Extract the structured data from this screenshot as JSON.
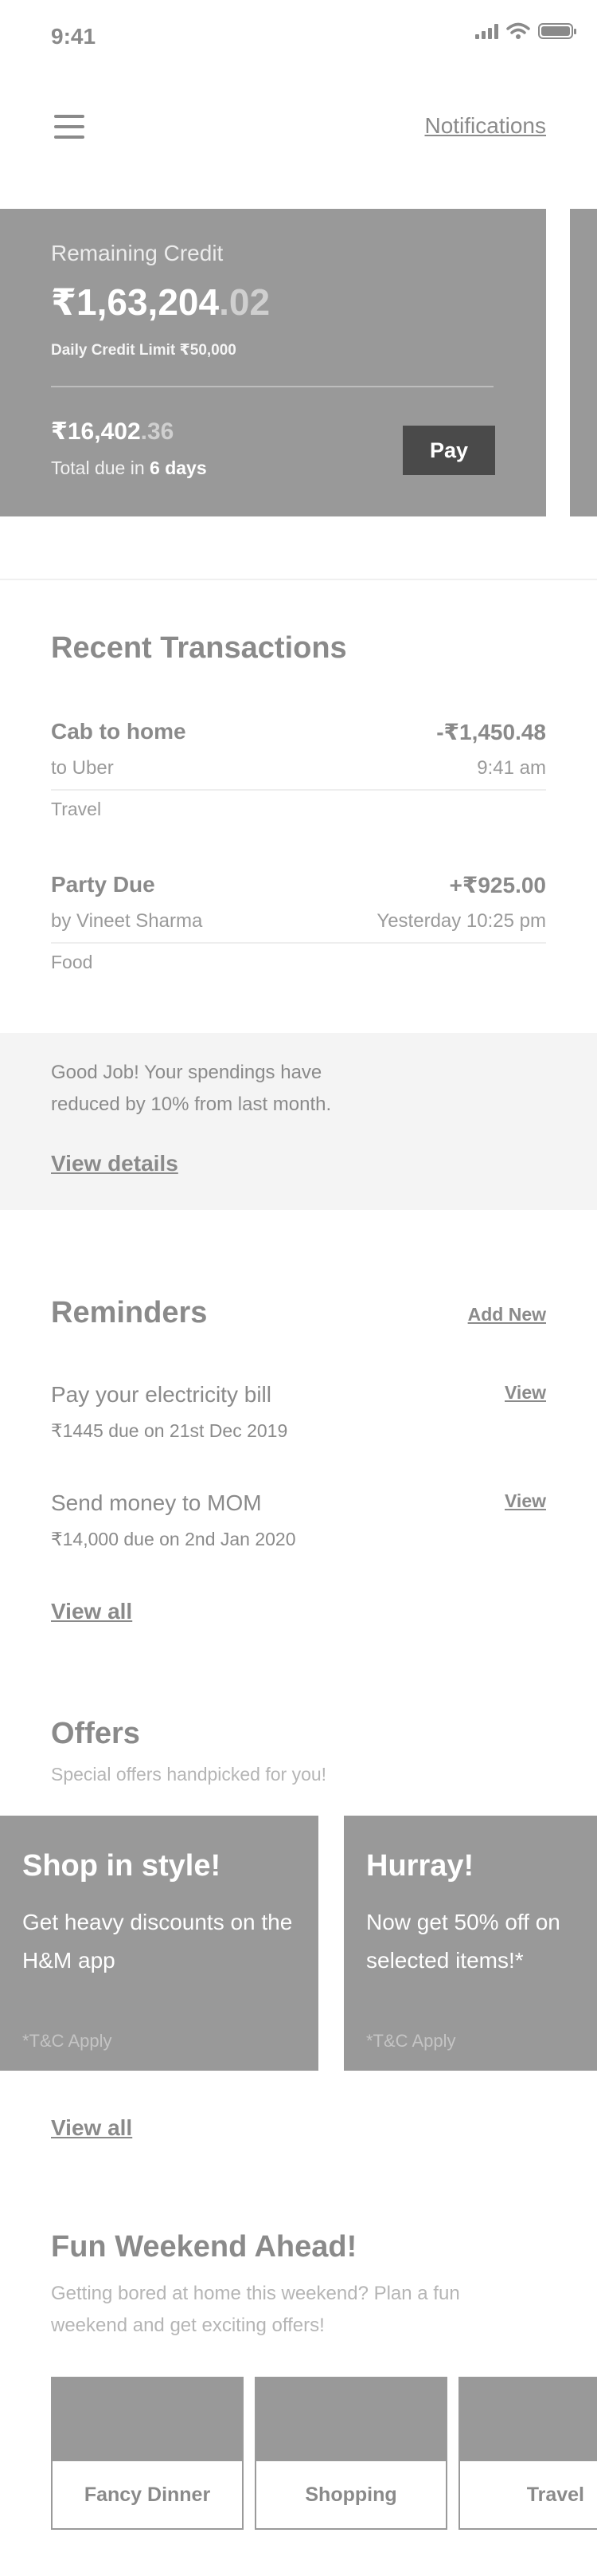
{
  "status_bar": {
    "time": "9:41"
  },
  "header": {
    "notifications_label": "Notifications"
  },
  "credit_card": {
    "label": "Remaining Credit",
    "currency": "₹",
    "amount_main": "1,63,204",
    "amount_decimal": ".02",
    "daily_limit_label": "Daily Credit Limit",
    "daily_limit_value": "₹50,000",
    "due_main": "16,402",
    "due_decimal": ".36",
    "due_label_prefix": "Total due in",
    "due_days": "6 days",
    "pay_label": "Pay"
  },
  "transactions": {
    "title": "Recent Transactions",
    "items": [
      {
        "title": "Cab to home",
        "amount": "-₹1,450.48",
        "sub": "to Uber",
        "time": "9:41 am",
        "category": "Travel"
      },
      {
        "title": "Party Due",
        "amount": "+₹925.00",
        "sub": "by Vineet Sharma",
        "time": "Yesterday 10:25 pm",
        "category": "Food"
      }
    ]
  },
  "insight": {
    "text": "Good Job! Your spendings have reduced by 10% from last month.",
    "link": "View details"
  },
  "reminders": {
    "title": "Reminders",
    "add_new": "Add New",
    "items": [
      {
        "title": "Pay your electricity bill",
        "sub": "₹1445 due on 21st Dec 2019",
        "action": "View"
      },
      {
        "title": "Send money to MOM",
        "sub": "₹14,000 due on 2nd Jan 2020",
        "action": "View"
      }
    ],
    "view_all": "View all"
  },
  "offers": {
    "title": "Offers",
    "subtitle": "Special offers handpicked for you!",
    "items": [
      {
        "title": "Shop in style!",
        "desc": "Get heavy discounts on the H&M app",
        "tc": "*T&C Apply"
      },
      {
        "title": "Hurray!",
        "desc": "Now get 50% off on selected items!*",
        "tc": "*T&C Apply"
      }
    ],
    "view_all": "View all"
  },
  "fun_weekend": {
    "title": "Fun Weekend Ahead!",
    "desc": "Getting bored at home this weekend? Plan a fun weekend and get exciting offers!",
    "cards": [
      "Fancy Dinner",
      "Shopping",
      "Travel"
    ]
  }
}
